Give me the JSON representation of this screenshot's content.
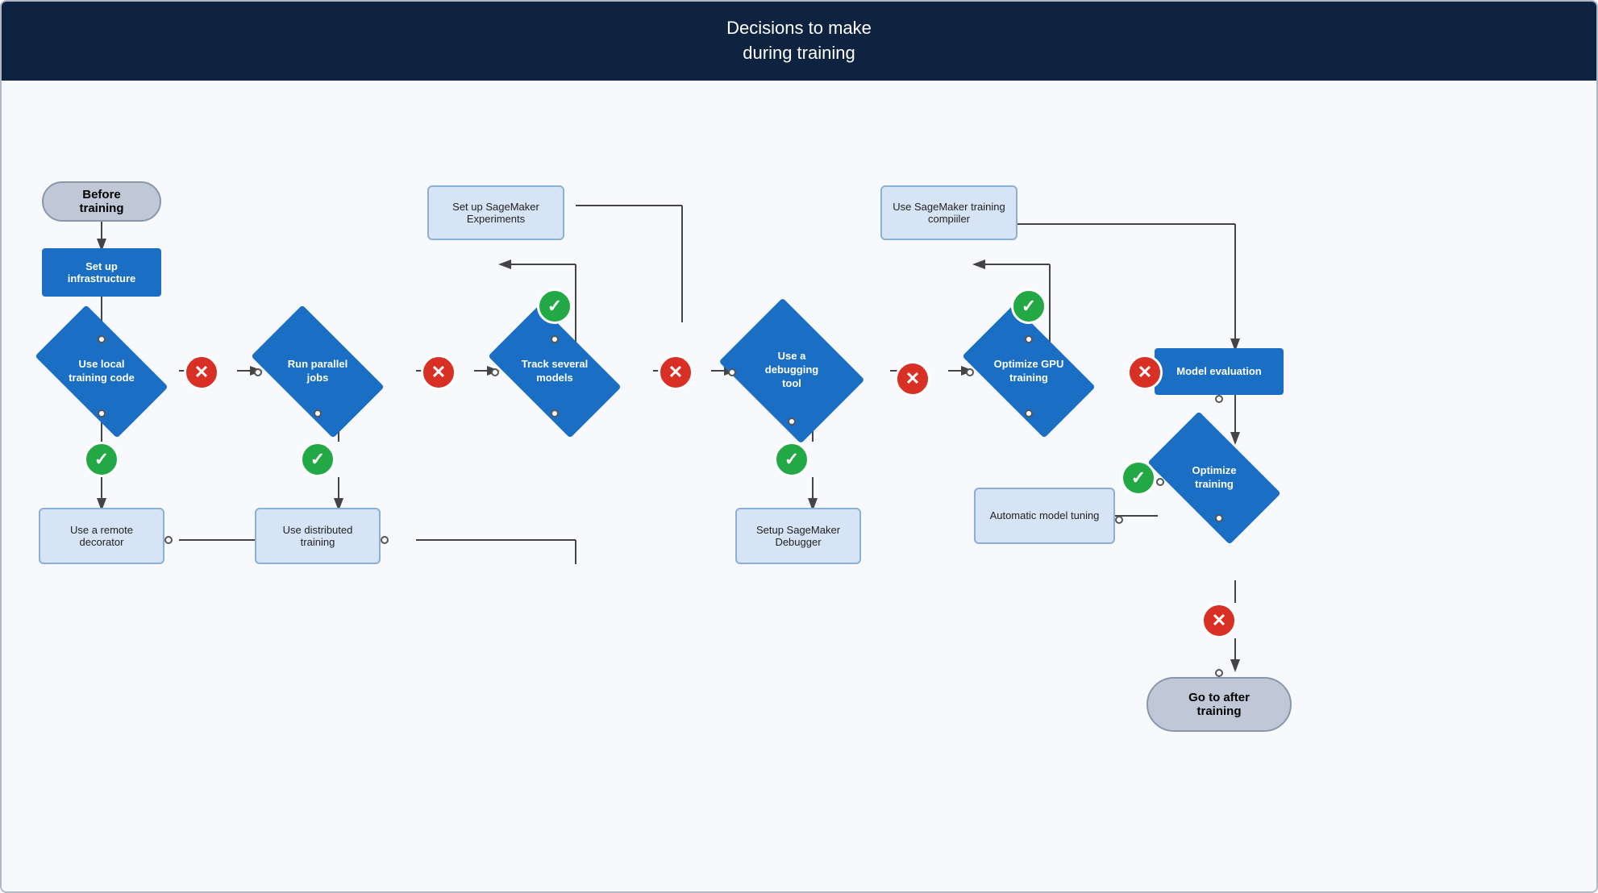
{
  "header": {
    "line1": "Decisions to make",
    "line2": "during training"
  },
  "nodes": {
    "before_training": "Before training",
    "set_up_infra": "Set up infrastructure",
    "use_local_training": "Use local\ntraining code",
    "use_remote_decorator": "Use a remote\ndecorator",
    "run_parallel_jobs": "Run parallel\njobs",
    "use_distributed": "Use distributed\ntraining",
    "set_up_sagemaker_exp": "Set up SageMaker\nExperiments",
    "track_several_models": "Track several\nmodels",
    "use_debugging_tool": "Use a\ndebugging\ntool",
    "setup_sagemaker_debugger": "Setup SageMaker\nDebugger",
    "use_sagemaker_compiler": "Use SageMaker\ntraining compiiler",
    "optimize_gpu_training": "Optimize GPU\ntraining",
    "model_evaluation": "Model evaluation",
    "optimize_training": "Optimize\ntraining",
    "automatic_model_tuning": "Automatic model\ntuning",
    "go_to_after_training": "Go to after\ntraining"
  }
}
